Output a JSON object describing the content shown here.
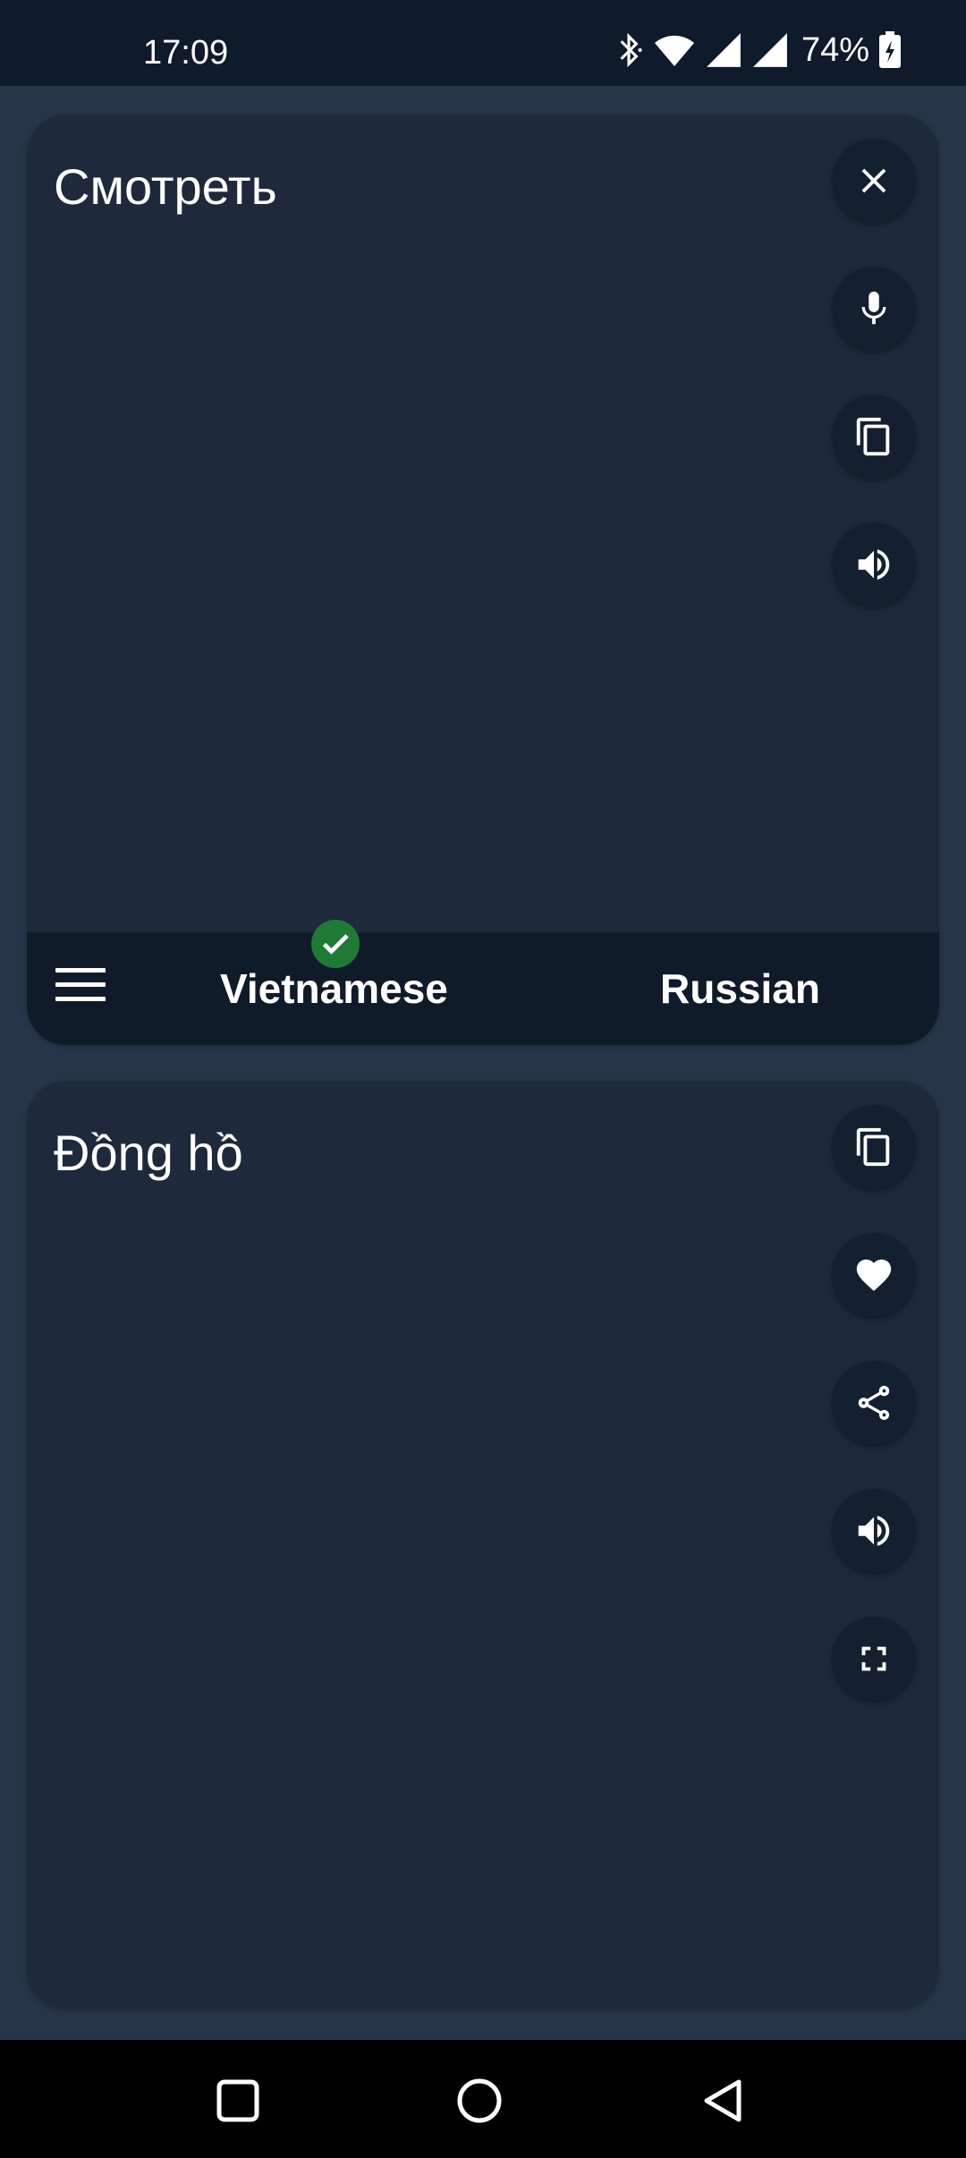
{
  "status_bar": {
    "time": "17:09",
    "battery_percent": "74%",
    "icons": [
      "bluetooth-icon",
      "wifi-icon",
      "signal-icon",
      "signal-icon",
      "battery-charging-icon"
    ]
  },
  "source_card": {
    "text": "Смотреть",
    "actions": [
      "close-icon",
      "microphone-icon",
      "copy-icon",
      "speaker-icon"
    ]
  },
  "language_bar": {
    "source_language": "Vietnamese",
    "target_language": "Russian",
    "selected": "Vietnamese",
    "selected_badge": "check-icon"
  },
  "target_card": {
    "text": "Đồng hồ",
    "actions": [
      "copy-icon",
      "heart-icon",
      "share-icon",
      "speaker-icon",
      "fullscreen-icon"
    ]
  },
  "nav_bar": {
    "buttons": [
      "recents-square-icon",
      "home-circle-icon",
      "back-triangle-icon"
    ]
  },
  "colors": {
    "background": "#263548",
    "card": "#1e2a3b",
    "bar": "#101b2a",
    "check": "#1f7a35"
  }
}
